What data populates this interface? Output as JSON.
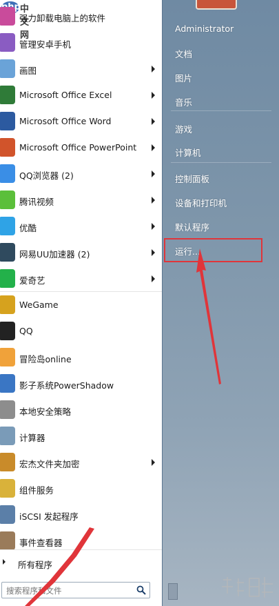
{
  "logo": {
    "part1": "php",
    "part2": "中文网"
  },
  "programs": [
    {
      "label": "强力卸载电脑上的软件",
      "icon": "uninstaller-icon",
      "arrow": false,
      "color": "#c94b9b"
    },
    {
      "label": "管理安卓手机",
      "icon": "android-manager-icon",
      "arrow": false,
      "color": "#8a5cc2"
    },
    {
      "label": "画图",
      "icon": "paint-icon",
      "arrow": true,
      "color": "#6aa3d8"
    },
    {
      "label": "Microsoft Office Excel",
      "icon": "excel-icon",
      "arrow": true,
      "color": "#2f7b38"
    },
    {
      "label": "Microsoft Office Word",
      "icon": "word-icon",
      "arrow": true,
      "color": "#2c5aa0"
    },
    {
      "label": "Microsoft Office PowerPoint",
      "icon": "powerpoint-icon",
      "arrow": true,
      "color": "#d1542b"
    },
    {
      "label": "QQ浏览器 (2)",
      "icon": "qq-browser-icon",
      "arrow": true,
      "color": "#3a8ee6"
    },
    {
      "label": "腾讯视频",
      "icon": "tencent-video-icon",
      "arrow": true,
      "color": "#5bbf3a"
    },
    {
      "label": "优酷",
      "icon": "youku-icon",
      "arrow": true,
      "color": "#2fa3e6"
    },
    {
      "label": "网易UU加速器 (2)",
      "icon": "uu-accelerator-icon",
      "arrow": true,
      "color": "#2f4a5e"
    },
    {
      "label": "爱奇艺",
      "icon": "iqiyi-icon",
      "arrow": true,
      "color": "#23b14a"
    },
    {
      "label": "WeGame",
      "icon": "wegame-icon",
      "arrow": false,
      "color": "#d6a21e"
    },
    {
      "label": "QQ",
      "icon": "qq-icon",
      "arrow": false,
      "color": "#222222"
    },
    {
      "label": "冒险岛online",
      "icon": "maplestory-icon",
      "arrow": false,
      "color": "#f0a23a"
    },
    {
      "label": "影子系统PowerShadow",
      "icon": "powershadow-icon",
      "arrow": false,
      "color": "#3a76c4"
    },
    {
      "label": "本地安全策略",
      "icon": "security-policy-icon",
      "arrow": false,
      "color": "#8d8d8d"
    },
    {
      "label": "计算器",
      "icon": "calculator-icon",
      "arrow": false,
      "color": "#7a9bb8"
    },
    {
      "label": "宏杰文件夹加密",
      "icon": "folder-encrypt-icon",
      "arrow": true,
      "color": "#c98b2a"
    },
    {
      "label": "组件服务",
      "icon": "component-services-icon",
      "arrow": false,
      "color": "#d9b23a"
    },
    {
      "label": "iSCSI 发起程序",
      "icon": "iscsi-icon",
      "arrow": false,
      "color": "#5b7fa8"
    },
    {
      "label": "事件查看器",
      "icon": "event-viewer-icon",
      "arrow": false,
      "color": "#9a7b5a"
    }
  ],
  "all_programs": "所有程序",
  "search": {
    "placeholder": "搜索程序和文件"
  },
  "right": [
    {
      "label": "Administrator"
    },
    {
      "label": "文档"
    },
    {
      "label": "图片"
    },
    {
      "label": "音乐"
    },
    {
      "label": "游戏"
    },
    {
      "label": "计算机"
    },
    {
      "label": "控制面板"
    },
    {
      "label": "设备和打印机"
    },
    {
      "label": "默认程序"
    },
    {
      "label": "运行..."
    }
  ],
  "colors": {
    "highlight": "#e0353a",
    "arrow": "#e0353a"
  }
}
